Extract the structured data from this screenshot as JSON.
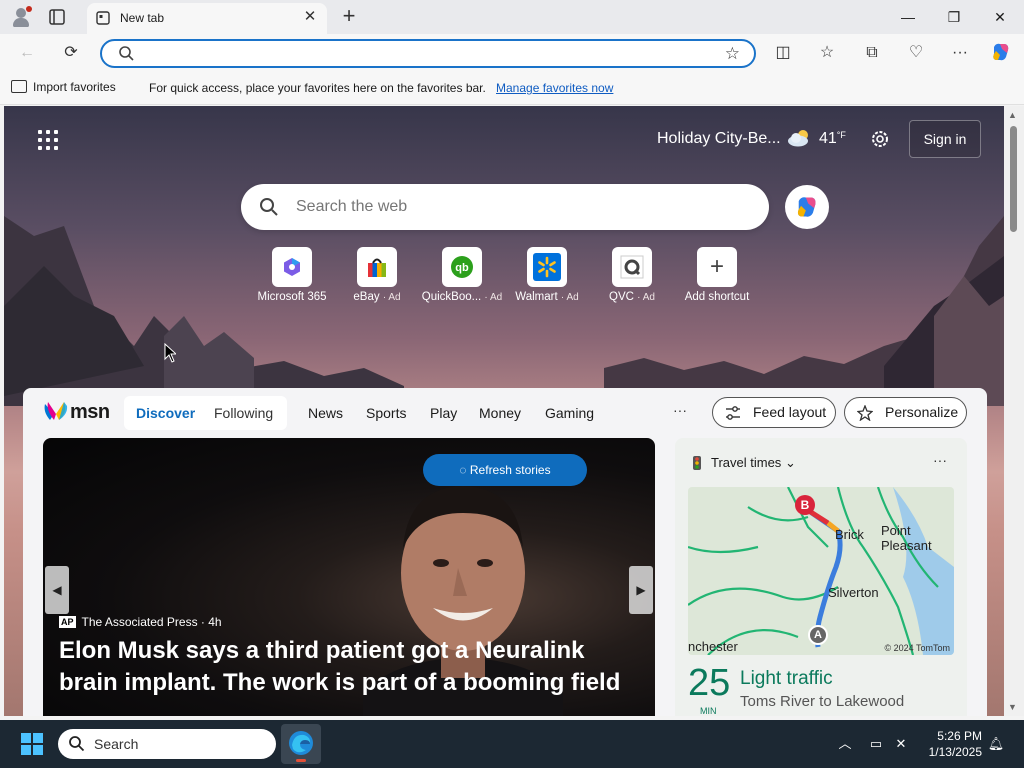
{
  "browser": {
    "tab_title": "New tab",
    "address_value": "",
    "favorites_bar": {
      "import_label": "Import favorites",
      "message": "For quick access, place your favorites here on the favorites bar.",
      "manage_link": "Manage favorites now"
    }
  },
  "ntp": {
    "location": "Holiday City-Be...",
    "temperature": "41",
    "temperature_unit": "°F",
    "sign_in": "Sign in",
    "search_placeholder": "Search the web",
    "shortcuts": [
      {
        "label": "Microsoft 365",
        "ad": ""
      },
      {
        "label": "eBay",
        "ad": "· Ad"
      },
      {
        "label": "QuickBoo...",
        "ad": "· Ad"
      },
      {
        "label": "Walmart",
        "ad": "· Ad"
      },
      {
        "label": "QVC",
        "ad": "· Ad"
      },
      {
        "label": "Add shortcut",
        "ad": ""
      }
    ]
  },
  "feed": {
    "brand": "msn",
    "tabs": [
      "Discover",
      "Following"
    ],
    "nav": [
      "News",
      "Sports",
      "Play",
      "Money",
      "Gaming"
    ],
    "more": "···",
    "feed_layout": "Feed layout",
    "personalize": "Personalize",
    "hero": {
      "refresh": "Refresh stories",
      "source_badge": "AP",
      "source": "The Associated Press",
      "age": "· 4h",
      "headline": "Elon Musk says a third patient got a Neuralink brain implant. The work is part of a booming field"
    },
    "travel": {
      "title": "Travel times",
      "more": "···",
      "map_labels": {
        "brick": "Brick",
        "point_pleasant": "Point\nPleasant",
        "silverton": "Silverton",
        "manchester": "nchester",
        "marker_a": "A",
        "marker_b": "B",
        "copyright": "© 2024 TomTom"
      },
      "minutes": "25",
      "minutes_label": "MIN",
      "status": "Light traffic",
      "route": "Toms River to Lakewood"
    }
  },
  "taskbar": {
    "search_placeholder": "Search",
    "time": "5:26 PM",
    "date": "1/13/2025"
  },
  "colors": {
    "accent": "#0f6cbd",
    "traffic_green": "#0b7a5c",
    "taskbar": "#1c2833"
  }
}
